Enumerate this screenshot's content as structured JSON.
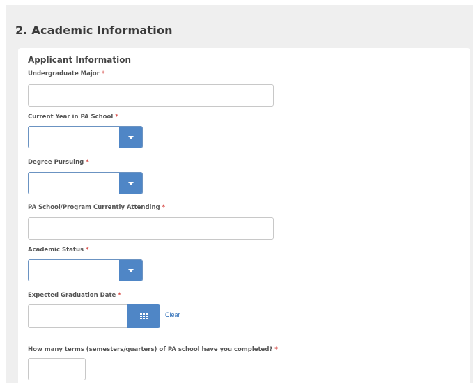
{
  "section": {
    "title": "2. Academic Information"
  },
  "card": {
    "subtitle": "Applicant Information",
    "required_marker": "*",
    "fields": {
      "undergrad_major": {
        "label": "Undergraduate Major",
        "value": ""
      },
      "current_year": {
        "label": "Current Year in PA School",
        "value": ""
      },
      "degree_pursuing": {
        "label": "Degree Pursuing",
        "value": ""
      },
      "pa_school": {
        "label": "PA School/Program Currently Attending",
        "value": ""
      },
      "academic_status": {
        "label": "Academic Status",
        "value": ""
      },
      "graduation_date": {
        "label": "Expected Graduation Date",
        "value": "",
        "clear_label": "Clear"
      },
      "terms_completed": {
        "label": "How many terms (semesters/quarters) of PA school have you completed?",
        "value": ""
      }
    }
  },
  "colors": {
    "accent": "#4f86c6",
    "required": "#d9534f",
    "link": "#2f6fb8",
    "panel_bg": "#efefef"
  },
  "icons": {
    "dropdown": "chevron-down-icon",
    "calendar": "calendar-icon"
  }
}
